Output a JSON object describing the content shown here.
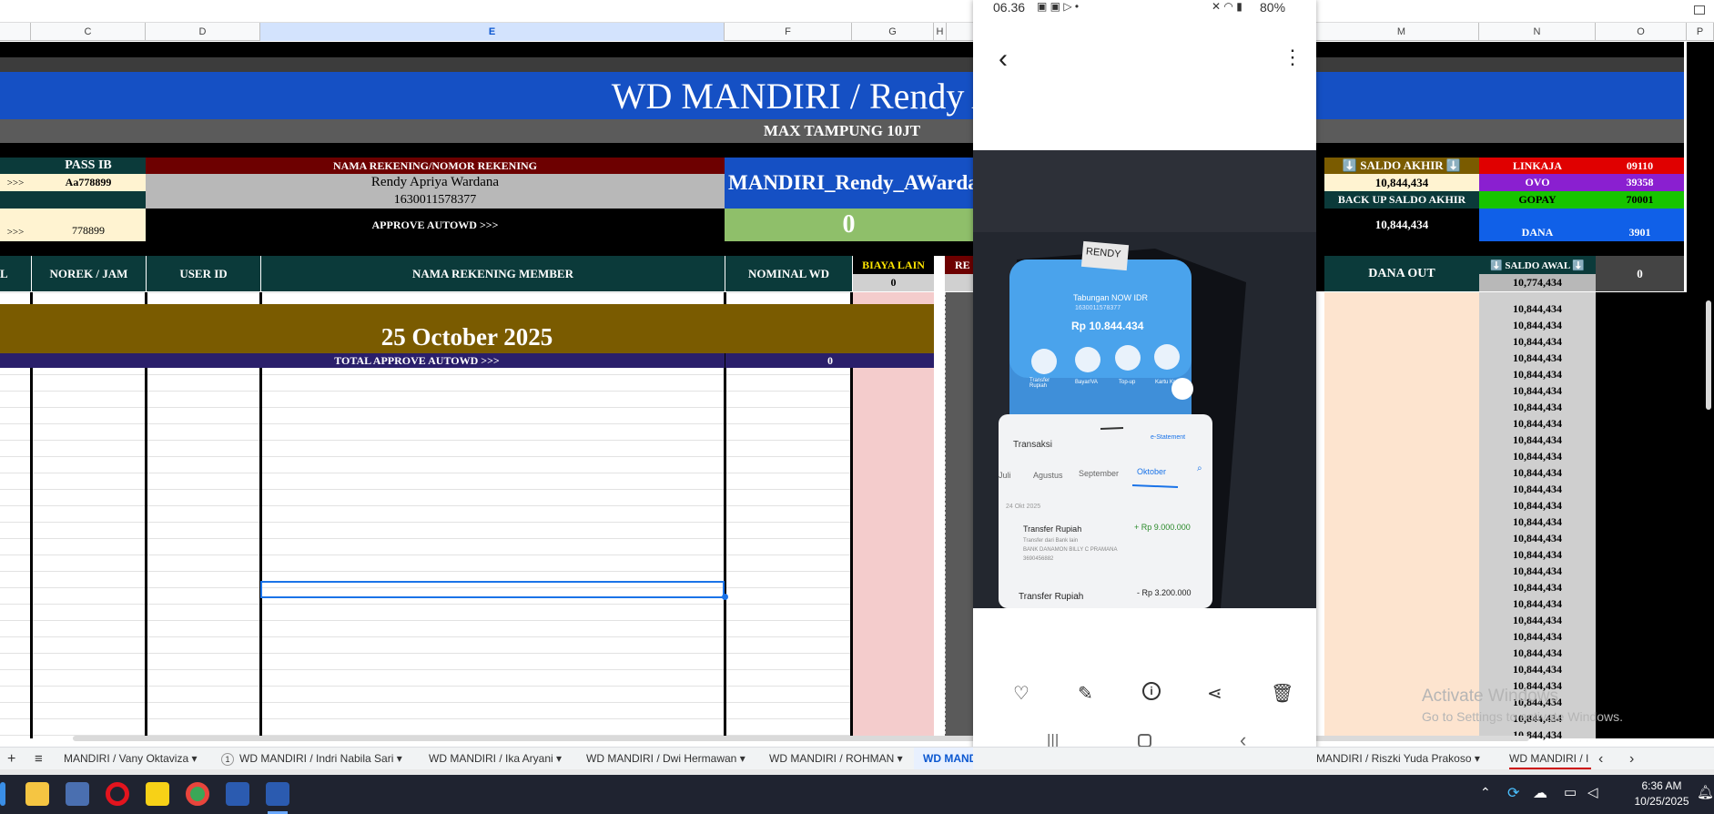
{
  "columns": [
    "C",
    "D",
    "E",
    "F",
    "G",
    "H",
    "M",
    "N",
    "O",
    "P"
  ],
  "sheet": {
    "title": "WD MANDIRI / Rendy Apriya",
    "subtitle": "MAX TAMPUNG 10JT",
    "pass_ib_header": "PASS IB",
    "pass_ib_value": "Aa778899",
    "pass_ib_value2": "778899",
    "arrow_left": ">>>",
    "arrow_left2": ">>>",
    "nama_rekening_header": "NAMA REKENING/NOMOR REKENING",
    "nama_rekening_value": "Rendy Apriya Wardana",
    "nomor_rekening_value": "1630011578377",
    "approve_autowd": "APPROVE AUTOWD >>>",
    "account_code": "MANDIRI_Rendy_AWardan",
    "autowd_value": "0",
    "saldo_akhir_header": "⬇️ SALDO AKHIR ⬇️",
    "saldo_akhir_value": "10,844,434",
    "backup_saldo_header": "BACK UP SALDO AKHIR",
    "backup_saldo_value": "10,844,434",
    "wallets": [
      {
        "name": "LINKAJA",
        "code": "09110",
        "color": "#e00000"
      },
      {
        "name": "OVO",
        "code": "39358",
        "color": "#8a1fd0"
      },
      {
        "name": "GOPAY",
        "code": "70001",
        "color": "#17c400"
      },
      {
        "name": "DANA",
        "code": "3901",
        "color": "#1060e8"
      }
    ],
    "col_headers": {
      "l": "L",
      "norek_jam": "NOREK / JAM",
      "user_id": "USER ID",
      "nama_rekening_member": "NAMA REKENING MEMBER",
      "nominal_wd": "NOMINAL WD",
      "biaya_lain": "BIAYA LAIN",
      "biaya_lain_value": "0",
      "re_header": "RE",
      "dana_out": "DANA OUT",
      "saldo_awal": "⬇️ SALDO AWAL ⬇️",
      "saldo_awal_value": "10,774,434",
      "o_value": "0"
    },
    "date_banner": "25 October 2025",
    "total_approve_label": "TOTAL APPROVE AUTOWD >>>",
    "total_approve_value": "0",
    "saldo_rows": [
      "10,844,434",
      "10,844,434",
      "10,844,434",
      "10,844,434",
      "10,844,434",
      "10,844,434",
      "10,844,434",
      "10,844,434",
      "10,844,434",
      "10,844,434",
      "10,844,434",
      "10,844,434",
      "10,844,434",
      "10,844,434",
      "10,844,434",
      "10,844,434",
      "10,844,434",
      "10,844,434",
      "10,844,434",
      "10,844,434",
      "10,844,434",
      "10,844,434",
      "10,844,434",
      "10,844,434",
      "10,844,434",
      "10,844,434",
      "10,844,434"
    ]
  },
  "phone": {
    "time": "06.36",
    "battery": "80%",
    "photo_label": "RENDY",
    "bank_screen": {
      "account_type": "Tabungan NOW IDR",
      "account_no": "1630011578377",
      "balance": "Rp 10.844.434",
      "actions": [
        "Transfer Rupiah",
        "Bayar/VA",
        "Top-up",
        "Kartu Kredit"
      ],
      "section": "Transaksi",
      "statement": "e-Statement",
      "months": [
        "Juli",
        "Agustus",
        "September",
        "Oktober"
      ],
      "date": "24 Okt 2025",
      "tx1_title": "Transfer Rupiah",
      "tx1_amount": "+ Rp 9.000.000",
      "tx1_desc": "Transfer dari Bank lain",
      "tx1_sub": "BANK DANAMON BILLY C PRAMANA",
      "tx1_ref": "3690456882",
      "tx2_title": "Transfer Rupiah",
      "tx2_amount": "- Rp 3.200.000"
    }
  },
  "watermark": {
    "line1": "Activate Windows",
    "line2": "Go to Settings to activate Windows."
  },
  "tabs": [
    {
      "label": "MANDIRI / Vany Oktaviza",
      "active": false
    },
    {
      "label": "WD MANDIRI / Indri Nabila Sari",
      "active": false,
      "badge": "1"
    },
    {
      "label": "WD MANDIRI / Ika Aryani",
      "active": false
    },
    {
      "label": "WD MANDIRI / Dwi Hermawan",
      "active": false
    },
    {
      "label": "WD MANDIRI / ROHMAN",
      "active": false
    },
    {
      "label": "WD MAND",
      "active": true
    },
    {
      "label": "MANDIRI / Riszki Yuda Prakoso",
      "active": false
    },
    {
      "label": "WD MANDIRI / I",
      "active": false
    }
  ],
  "taskbar": {
    "time": "6:36 AM",
    "date": "10/25/2025"
  }
}
